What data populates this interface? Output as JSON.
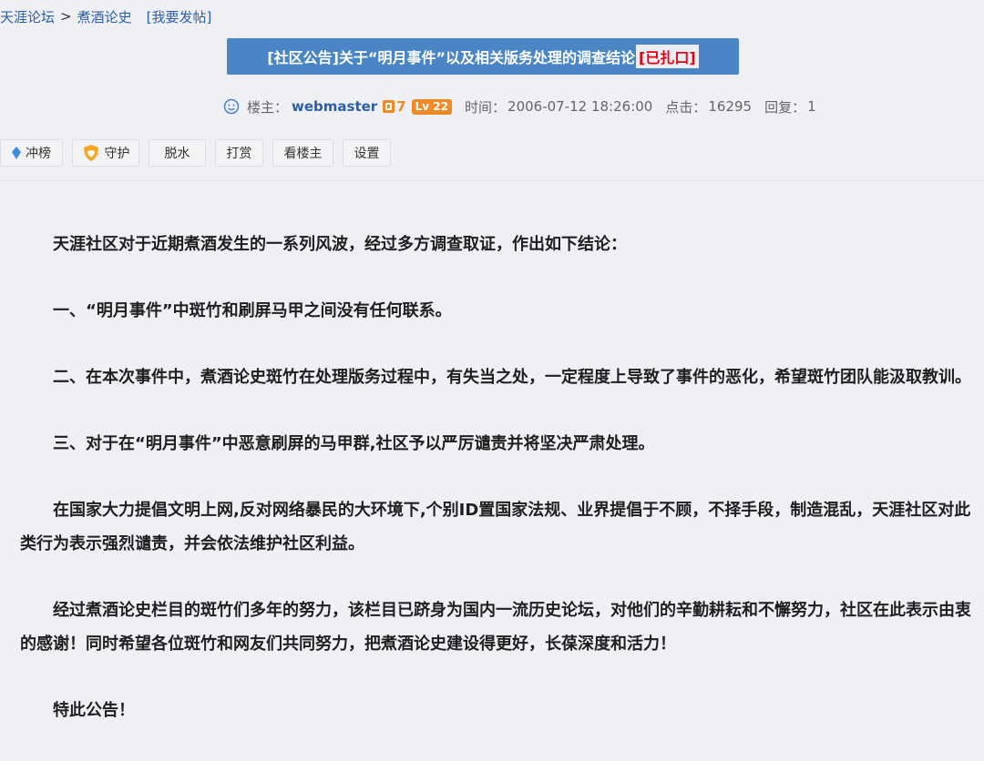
{
  "breadcrumb": {
    "forum": "天涯论坛",
    "separator": ">",
    "board": "煮酒论史",
    "post_link": "[我要发帖]"
  },
  "post": {
    "title": "[社区公告]关于“明月事件”以及相关版务处理的调查结论",
    "status": "[已扎口]"
  },
  "meta": {
    "author_label": "楼主：",
    "author": "webmaster",
    "badge_count": "7",
    "level": "Lv 22",
    "time_label": "时间：",
    "time": "2006-07-12 18:26:00",
    "clicks_label": "点击：",
    "clicks": "16295",
    "replies_label": "回复：",
    "replies": "1"
  },
  "toolbar": {
    "rank": "冲榜",
    "guard": "守护",
    "dehydrate": "脱水",
    "reward": "打赏",
    "op_only": "看楼主",
    "settings": "设置"
  },
  "content": {
    "p1": "天涯社区对于近期煮酒发生的一系列风波，经过多方调查取证，作出如下结论：",
    "p2": "一、“明月事件”中斑竹和刷屏马甲之间没有任何联系。",
    "p3": "二、在本次事件中，煮酒论史斑竹在处理版务过程中，有失当之处，一定程度上导致了事件的恶化，希望斑竹团队能汲取教训。",
    "p4": "三、对于在“明月事件”中恶意刷屏的马甲群,社区予以严厉谴责并将坚决严肃处理。",
    "p5": "在国家大力提倡文明上网,反对网络暴民的大环境下,个别ID置国家法规、业界提倡于不顾，不择手段，制造混乱，天涯社区对此类行为表示强烈谴责，并会依法维护社区利益。",
    "p6": "经过煮酒论史栏目的斑竹们多年的努力，该栏目已跻身为国内一流历史论坛，对他们的辛勤耕耘和不懈努力，社区在此表示由衷的感谢！同时希望各位斑竹和网友们共同努力，把煮酒论史建设得更好，长葆深度和活力！",
    "p7": "特此公告！"
  },
  "colors": {
    "link": "#2d5fa8",
    "title_bg": "#4a86c5",
    "status_red": "#e60012",
    "badge_orange": "#f08a24"
  }
}
